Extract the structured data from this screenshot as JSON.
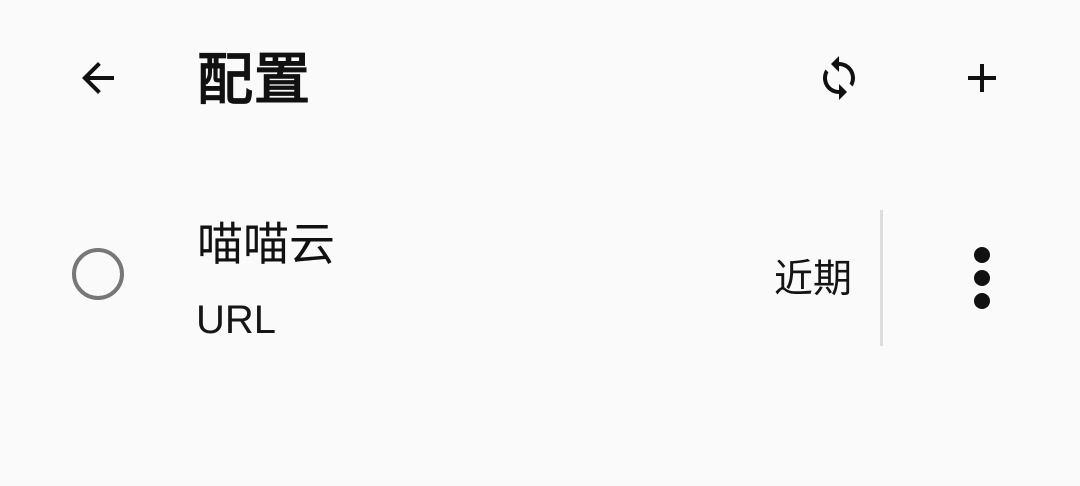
{
  "header": {
    "title": "配置",
    "back_icon": "arrow-back-icon",
    "sync_icon": "sync-icon",
    "add_icon": "add-icon"
  },
  "profile": {
    "name": "喵喵云",
    "type": "URL",
    "update": "近期",
    "selected": false,
    "more_icon": "more-vertical-icon"
  },
  "colors": {
    "background": "#fafafa",
    "text": "#111111",
    "radio_border": "#777777",
    "divider": "#dddddd"
  }
}
